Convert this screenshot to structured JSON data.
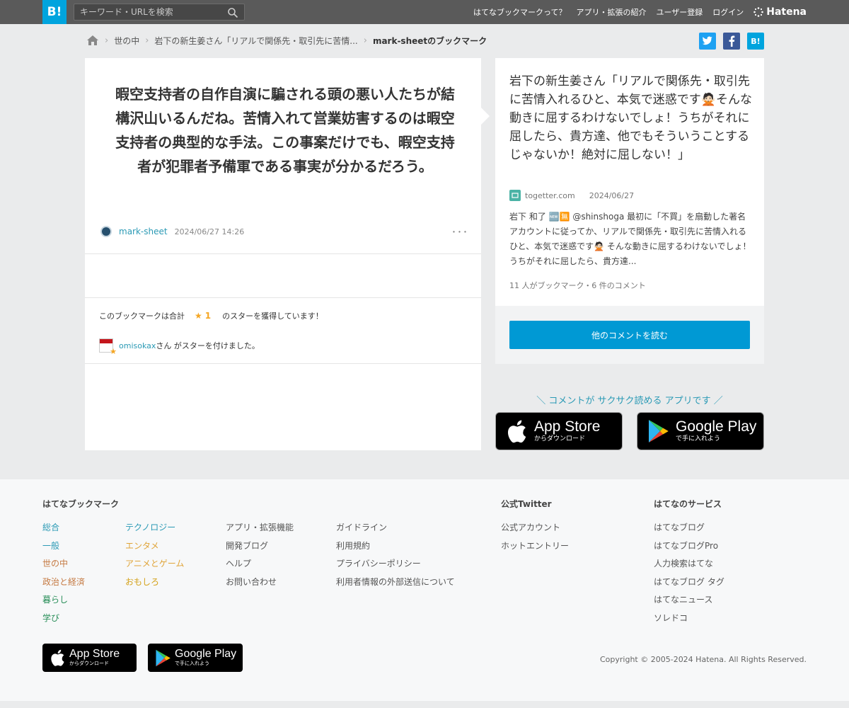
{
  "header": {
    "logo": "B!",
    "search_placeholder": "キーワード・URLを検索",
    "nav": [
      "はてなブックマークって？",
      "アプリ・拡張の紹介",
      "ユーザー登録",
      "ログイン"
    ],
    "brand": "Hatena"
  },
  "breadcrumb": {
    "items": [
      "世の中",
      "岩下の新生姜さん「リアルで関係先・取引先に苦情..."
    ],
    "current": "mark-sheetのブックマーク"
  },
  "share": {
    "hatena": "B!"
  },
  "bookmark": {
    "comment": "暇空支持者の自作自演に騙される頭の悪い人たちが結構沢山いるんだね。苦情入れて営業妨害するのは暇空支持者の典型的な手法。この事案だけでも、暇空支持者が犯罪者予備軍である事実が分かるだろう。",
    "user": "mark-sheet",
    "date": "2024/06/27 14:26",
    "more": "･･･",
    "stars_prefix": "このブックマークは合計",
    "stars_icon": "★",
    "stars_count": "1",
    "stars_suffix": "のスターを獲得しています！",
    "starred_user": "omisokax",
    "starred_suffix": "さん がスターを付けました。"
  },
  "entry": {
    "title": "岩下の新生姜さん「リアルで関係先・取引先に苦情入れるひと、本気で迷惑です🙅🏻そんな動きに屈するわけないでしょ！うちがそれに屈したら、貴方達、他でもそういうことするじゃないか！絶対に屈しない！」",
    "domain": "togetter.com",
    "date": "2024/06/27",
    "description": "岩下 和了 🆕🈚 @shinshoga 最初に「不買」を扇動した著名アカウントに従ってか、リアルで関係先・取引先に苦情入れるひと、本気で迷惑です🙅🏻 そんな動きに屈するわけないでしょ！うちがそれに屈したら、貴方達...",
    "count": "11 人がブックマーク・6 件のコメント",
    "more_button": "他のコメントを読む"
  },
  "app_promo": {
    "text": "＼ コメントが サクサク読める アプリです ／",
    "app_store_main": "App Store",
    "app_store_sub": "からダウンロード",
    "google_play_main": "Google Play",
    "google_play_sub": "で手に入れよう"
  },
  "footer": {
    "col1_title": "はてなブックマーク",
    "col1a": [
      "総合",
      "一般",
      "世の中",
      "政治と経済",
      "暮らし",
      "学び"
    ],
    "col1b": [
      "テクノロジー",
      "エンタメ",
      "アニメとゲーム",
      "おもしろ"
    ],
    "col2": [
      "アプリ・拡張機能",
      "開発ブログ",
      "ヘルプ",
      "お問い合わせ"
    ],
    "col3": [
      "ガイドライン",
      "利用規約",
      "プライバシーポリシー",
      "利用者情報の外部送信について"
    ],
    "col4_title": "公式Twitter",
    "col4": [
      "公式アカウント",
      "ホットエントリー"
    ],
    "col5_title": "はてなのサービス",
    "col5": [
      "はてなブログ",
      "はてなブログPro",
      "人力検索はてな",
      "はてなブログ タグ",
      "はてなニュース",
      "ソレドコ"
    ],
    "copyright": "Copyright © 2005-2024 Hatena. All Rights Reserved."
  }
}
